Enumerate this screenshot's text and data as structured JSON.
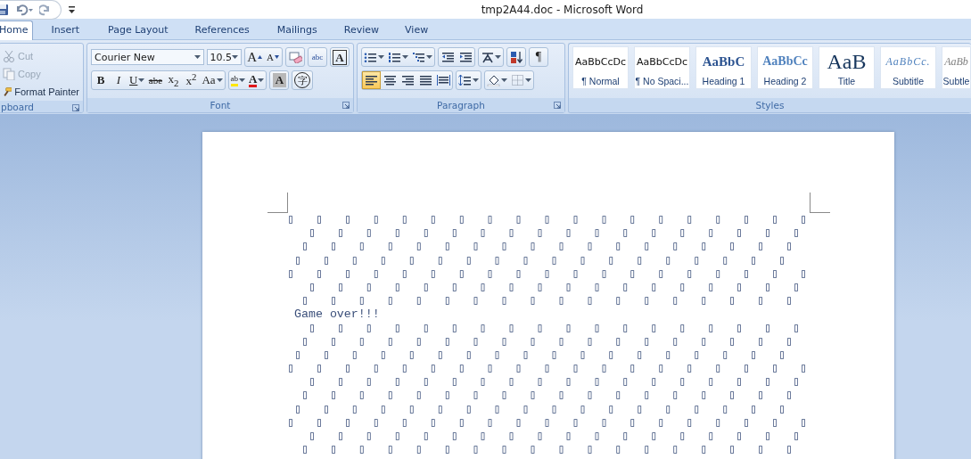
{
  "window": {
    "title": "tmp2A44.doc - Microsoft Word"
  },
  "tabs": [
    {
      "label": "Home",
      "selected": true
    },
    {
      "label": "Insert",
      "selected": false
    },
    {
      "label": "Page Layout",
      "selected": false
    },
    {
      "label": "References",
      "selected": false
    },
    {
      "label": "Mailings",
      "selected": false
    },
    {
      "label": "Review",
      "selected": false
    },
    {
      "label": "View",
      "selected": false
    }
  ],
  "clipboard": {
    "label": "pboard",
    "items": [
      {
        "kind": "cut",
        "label": "Cut",
        "disabled": true
      },
      {
        "kind": "copy",
        "label": "Copy",
        "disabled": true
      },
      {
        "kind": "painter",
        "label": "Format Painter",
        "disabled": false
      }
    ]
  },
  "font": {
    "label": "Font",
    "name": "Courier New",
    "size": "10.5",
    "row1": [
      {
        "kind": "grow",
        "label": "A"
      },
      {
        "kind": "shrink",
        "label": "A"
      },
      {
        "kind": "clear"
      },
      {
        "kind": "phonetic",
        "label": "abc"
      },
      {
        "kind": "border",
        "label": "A"
      }
    ],
    "row2": [
      {
        "kind": "bold",
        "label": "B"
      },
      {
        "kind": "italic",
        "label": "I"
      },
      {
        "kind": "underline",
        "label": "U"
      },
      {
        "kind": "strike",
        "label": "abe"
      },
      {
        "kind": "sub",
        "label": "x$_{2}$"
      },
      {
        "kind": "sup",
        "label": "x$^{2}$"
      },
      {
        "kind": "case",
        "label": "Aa"
      },
      {
        "kind": "highlight",
        "label": "ab"
      },
      {
        "kind": "color",
        "label": "A"
      },
      {
        "kind": "shade",
        "label": "A"
      },
      {
        "kind": "enclose",
        "label": "字"
      }
    ]
  },
  "paragraph": {
    "label": "Paragraph",
    "row1": [
      {
        "kind": "bullets"
      },
      {
        "kind": "numbering"
      },
      {
        "kind": "multilevel"
      },
      {
        "kind": "outdent"
      },
      {
        "kind": "indent"
      },
      {
        "kind": "asian"
      },
      {
        "kind": "sort"
      },
      {
        "kind": "marks",
        "label": "¶"
      }
    ],
    "row2": [
      {
        "kind": "left",
        "selected": true
      },
      {
        "kind": "center",
        "selected": false
      },
      {
        "kind": "right",
        "selected": false
      },
      {
        "kind": "justify",
        "selected": false
      },
      {
        "kind": "distribute",
        "selected": false
      },
      {
        "kind": "spacing"
      },
      {
        "kind": "shading"
      },
      {
        "kind": "borders"
      }
    ]
  },
  "styles": {
    "label": "Styles",
    "items": [
      {
        "kind": "normal",
        "preview": "AaBbCcDc",
        "name": "¶ Normal"
      },
      {
        "kind": "nospacing",
        "preview": "AaBbCcDc",
        "name": "¶ No Spaci..."
      },
      {
        "kind": "heading1",
        "preview": "AaBbC",
        "name": "Heading 1"
      },
      {
        "kind": "heading2",
        "preview": "AaBbCc",
        "name": "Heading 2"
      },
      {
        "kind": "title",
        "preview": "AaB",
        "name": "Title"
      },
      {
        "kind": "subtitle",
        "preview": "AaBbCc.",
        "name": "Subtitle"
      },
      {
        "kind": "subtle",
        "preview": "AaBb",
        "name": "Subtle"
      }
    ]
  },
  "document": {
    "lines": [
      "▯   ▯   ▯   ▯   ▯   ▯   ▯   ▯   ▯   ▯   ▯   ▯   ▯   ▯   ▯   ▯   ▯   ▯   ▯",
      "   ▯   ▯   ▯   ▯   ▯   ▯   ▯   ▯   ▯   ▯   ▯   ▯   ▯   ▯   ▯   ▯   ▯   ▯",
      "  ▯   ▯   ▯   ▯   ▯   ▯   ▯   ▯   ▯   ▯   ▯   ▯   ▯   ▯   ▯   ▯   ▯   ▯",
      " ▯   ▯   ▯   ▯   ▯   ▯   ▯   ▯   ▯   ▯   ▯   ▯   ▯   ▯   ▯   ▯   ▯   ▯",
      "▯   ▯   ▯   ▯   ▯   ▯   ▯   ▯   ▯   ▯   ▯   ▯   ▯   ▯   ▯   ▯   ▯   ▯   ▯",
      "   ▯   ▯   ▯   ▯   ▯   ▯   ▯   ▯   ▯   ▯   ▯   ▯   ▯   ▯   ▯   ▯   ▯   ▯",
      "  ▯   ▯   ▯   ▯   ▯   ▯   ▯   ▯   ▯   ▯   ▯   ▯   ▯   ▯   ▯   ▯   ▯   ▯",
      " Game over!!!",
      "   ▯   ▯   ▯   ▯   ▯   ▯   ▯   ▯   ▯   ▯   ▯   ▯   ▯   ▯   ▯   ▯   ▯   ▯",
      "  ▯   ▯   ▯   ▯   ▯   ▯   ▯   ▯   ▯   ▯   ▯   ▯   ▯   ▯   ▯   ▯   ▯   ▯",
      " ▯   ▯   ▯   ▯   ▯   ▯   ▯   ▯   ▯   ▯   ▯   ▯   ▯   ▯   ▯   ▯   ▯   ▯",
      "▯   ▯   ▯   ▯   ▯   ▯   ▯   ▯   ▯   ▯   ▯   ▯   ▯   ▯   ▯   ▯   ▯   ▯   ▯",
      "   ▯   ▯   ▯   ▯   ▯   ▯   ▯   ▯   ▯   ▯   ▯   ▯   ▯   ▯   ▯   ▯   ▯   ▯",
      "  ▯   ▯   ▯   ▯   ▯   ▯   ▯   ▯   ▯   ▯   ▯   ▯   ▯   ▯   ▯   ▯   ▯   ▯",
      " ▯   ▯   ▯   ▯   ▯   ▯   ▯   ▯   ▯   ▯   ▯   ▯   ▯   ▯   ▯   ▯   ▯   ▯",
      "▯   ▯   ▯   ▯   ▯   ▯   ▯   ▯   ▯   ▯   ▯   ▯   ▯   ▯   ▯   ▯   ▯   ▯   ▯",
      "   ▯   ▯   ▯   ▯   ▯   ▯   ▯   ▯   ▯   ▯   ▯   ▯   ▯   ▯   ▯   ▯   ▯   ▯",
      "  ▯   ▯   ▯   ▯   ▯   ▯   ▯   ▯   ▯   ▯   ▯   ▯   ▯   ▯   ▯   ▯   ▯   ▯"
    ]
  }
}
